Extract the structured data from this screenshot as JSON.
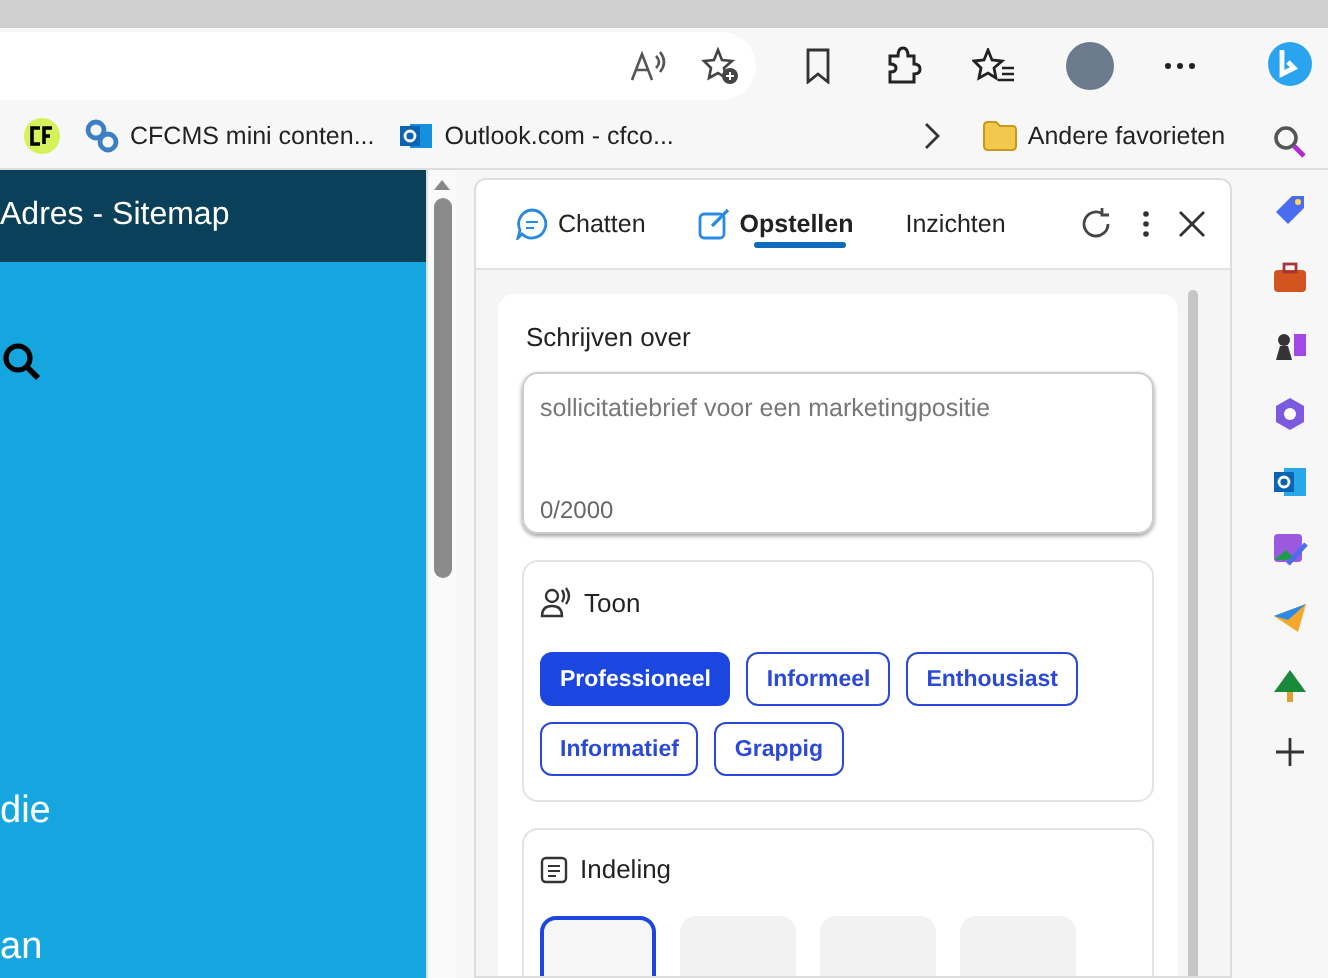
{
  "bookmarks": [
    {
      "kind": "cf"
    },
    {
      "kind": "gear",
      "label": "CFCMS mini conten..."
    },
    {
      "kind": "mail",
      "label": "Outlook.com - cfco..."
    }
  ],
  "other_favorites": "Andere favorieten",
  "page": {
    "header": "Adres - Sitemap",
    "texts": [
      "die",
      "an"
    ]
  },
  "copilot": {
    "tabs": [
      {
        "label": "Chatten",
        "kind": "chat",
        "selected": false
      },
      {
        "label": "Opstellen",
        "kind": "compose",
        "selected": true
      },
      {
        "label": "Inzichten",
        "kind": "plain",
        "selected": false
      }
    ],
    "write_about": {
      "label": "Schrijven over",
      "placeholder": "sollicitatiebrief voor een marketingpositie",
      "counter": "0/2000"
    },
    "tone": {
      "title": "Toon",
      "options": [
        {
          "label": "Professioneel",
          "selected": true
        },
        {
          "label": "Informeel",
          "selected": false
        },
        {
          "label": "Enthousiast",
          "selected": false
        },
        {
          "label": "Informatief",
          "selected": false
        },
        {
          "label": "Grappig",
          "selected": false
        }
      ]
    },
    "format": {
      "title": "Indeling",
      "options": [
        {
          "selected": true
        },
        {
          "selected": false
        },
        {
          "selected": false
        },
        {
          "selected": false
        }
      ]
    }
  }
}
